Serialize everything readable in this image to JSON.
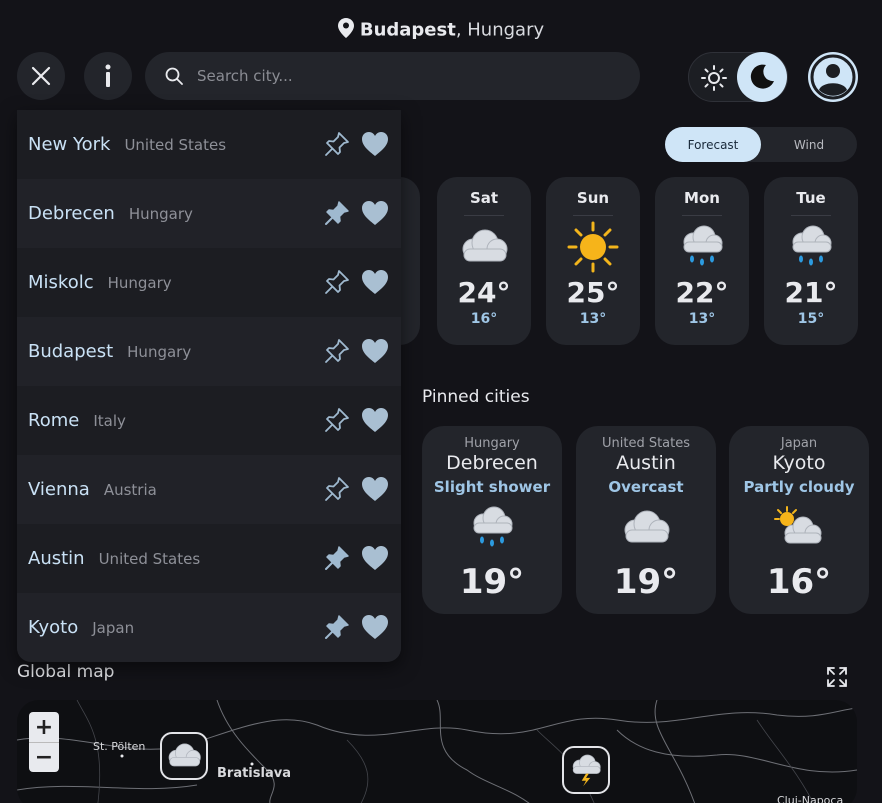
{
  "header": {
    "city": "Budapest",
    "country": ", Hungary"
  },
  "search": {
    "placeholder": "Search city..."
  },
  "tabs": [
    {
      "label": "Forecast",
      "active": true
    },
    {
      "label": "Wind",
      "active": false
    }
  ],
  "forecast": [
    {
      "day": "Sat",
      "high": "24°",
      "low": "16°",
      "icon": "cloudy-icon"
    },
    {
      "day": "Sun",
      "high": "25°",
      "low": "13°",
      "icon": "sunny-icon"
    },
    {
      "day": "Mon",
      "high": "22°",
      "low": "13°",
      "icon": "rain-cloud-icon"
    },
    {
      "day": "Tue",
      "high": "21°",
      "low": "15°",
      "icon": "rain-cloud-icon"
    }
  ],
  "pinned": {
    "title": "Pinned cities",
    "cities": [
      {
        "country": "Hungary",
        "name": "Debrecen",
        "condition": "Slight shower",
        "temp": "19°",
        "icon": "rain-cloud-icon"
      },
      {
        "country": "United States",
        "name": "Austin",
        "condition": "Overcast",
        "temp": "19°",
        "icon": "cloudy-icon"
      },
      {
        "country": "Japan",
        "name": "Kyoto",
        "condition": "Partly cloudy",
        "temp": "16°",
        "icon": "partly-cloudy-icon"
      }
    ]
  },
  "map": {
    "title": "Global map",
    "zoom_in": "+",
    "zoom_out": "−",
    "labels": [
      "St. Pölten",
      "Bratislava",
      "Cluj-Napoca"
    ]
  },
  "dropdown": {
    "items": [
      {
        "city": "New York",
        "country": "United States",
        "pinned": false
      },
      {
        "city": "Debrecen",
        "country": "Hungary",
        "pinned": true
      },
      {
        "city": "Miskolc",
        "country": "Hungary",
        "pinned": false
      },
      {
        "city": "Budapest",
        "country": "Hungary",
        "pinned": false
      },
      {
        "city": "Rome",
        "country": "Italy",
        "pinned": false
      },
      {
        "city": "Vienna",
        "country": "Austria",
        "pinned": false
      },
      {
        "city": "Austin",
        "country": "United States",
        "pinned": true
      },
      {
        "city": "Kyoto",
        "country": "Japan",
        "pinned": true
      }
    ]
  },
  "colors": {
    "accent": "#cfe5f7",
    "background": "#131318",
    "card": "#23252b",
    "condition_text": "#9fc6e6"
  }
}
